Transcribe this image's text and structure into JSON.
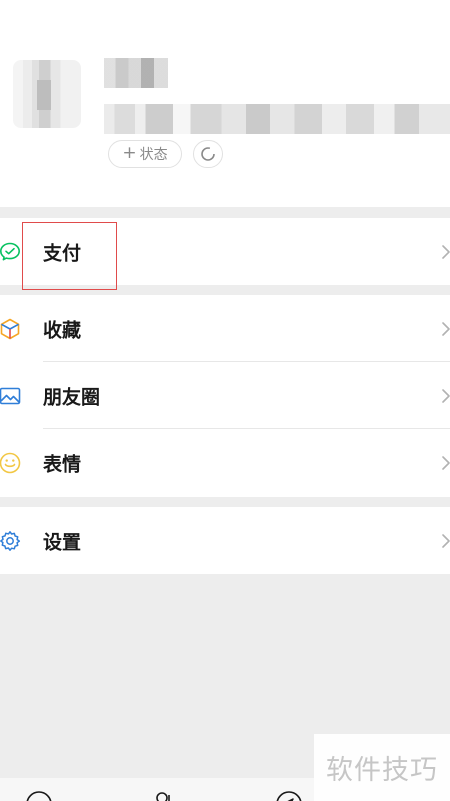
{
  "profile": {
    "status_label": "状态",
    "status_plus": "+"
  },
  "menu": {
    "pay": {
      "label": "支付",
      "icon": "wechat-pay-icon"
    },
    "favorites": {
      "label": "收藏",
      "icon": "favorites-cube-icon"
    },
    "moments": {
      "label": "朋友圈",
      "icon": "moments-photo-icon"
    },
    "stickers": {
      "label": "表情",
      "icon": "sticker-smile-icon"
    },
    "settings": {
      "label": "设置",
      "icon": "gear-icon"
    }
  },
  "watermark": "软件技巧",
  "colors": {
    "pay_green": "#07c160",
    "favorites_orange": "#f6a623",
    "moments_blue": "#2f7ed8",
    "sticker_yellow": "#f2c744",
    "settings_blue": "#2f7ed8",
    "highlight_red": "#e04b4b"
  }
}
